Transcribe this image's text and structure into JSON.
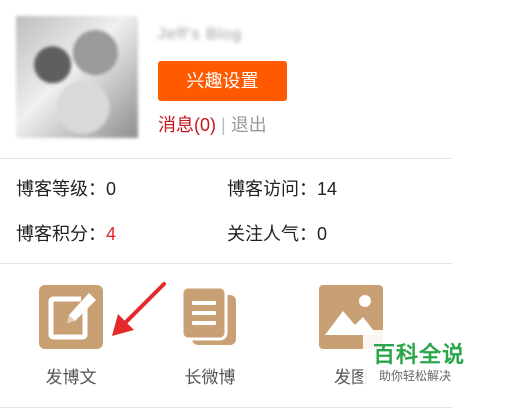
{
  "profile": {
    "username": "Jeff's Blog",
    "interest_button": "兴趣设置",
    "messages_label": "消息(0)",
    "separator": "|",
    "logout_label": "退出"
  },
  "stats": [
    {
      "label": "博客等级：",
      "value": "0"
    },
    {
      "label": "博客访问：",
      "value": "14"
    },
    {
      "label": "博客积分：",
      "value": "4"
    },
    {
      "label": "关注人气：",
      "value": "0"
    }
  ],
  "actions": [
    {
      "label": "发博文",
      "icon": "edit-icon"
    },
    {
      "label": "长微博",
      "icon": "document-icon"
    },
    {
      "label": "发图",
      "icon": "picture-icon"
    }
  ],
  "watermark": {
    "title": "百科全说",
    "subtitle": "助你轻松解决"
  },
  "colors": {
    "accent_orange": "#ff5a00",
    "message_red": "#c8151d",
    "icon_tan": "#c9a074",
    "arrow_red": "#e32b2b",
    "watermark_green": "#2aa64a"
  }
}
